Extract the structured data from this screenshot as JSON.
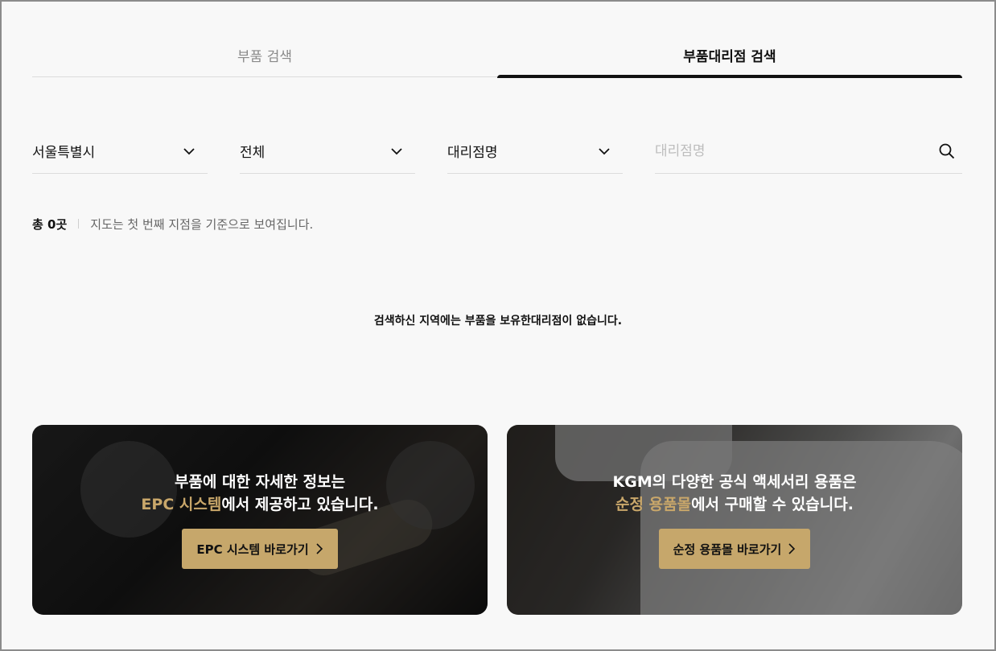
{
  "tabs": [
    {
      "label": "부품 검색",
      "active": false
    },
    {
      "label": "부품대리점 검색",
      "active": true
    }
  ],
  "filters": {
    "region": "서울특별시",
    "district": "전체",
    "type": "대리점명",
    "search_placeholder": "대리점명",
    "search_value": ""
  },
  "summary": {
    "total": "총 0곳",
    "note": "지도는 첫 번째 지점을 기준으로 보여집니다."
  },
  "empty_message": "검색하신 지역에는 부품을 보유한대리점이 없습니다.",
  "banners": [
    {
      "line1": "부품에 대한 자세한 정보는",
      "line2_highlight": "EPC 시스템",
      "line2_rest": "에서 제공하고 있습니다.",
      "button_label": "EPC 시스템 바로가기"
    },
    {
      "line1": "KGM의 다양한 공식 액세서리 용품은",
      "line2_highlight": "순정 용품몰",
      "line2_rest": "에서 구매할 수 있습니다.",
      "button_label": "순정 용품몰 바로가기"
    }
  ],
  "colors": {
    "accent": "#c6a76b",
    "highlight": "#c9a76a",
    "text": "#111111",
    "muted": "#8a8a8a"
  },
  "icons": {
    "dropdown": "chevron-down-icon",
    "search": "search-icon",
    "button_arrow": "chevron-right-icon"
  }
}
